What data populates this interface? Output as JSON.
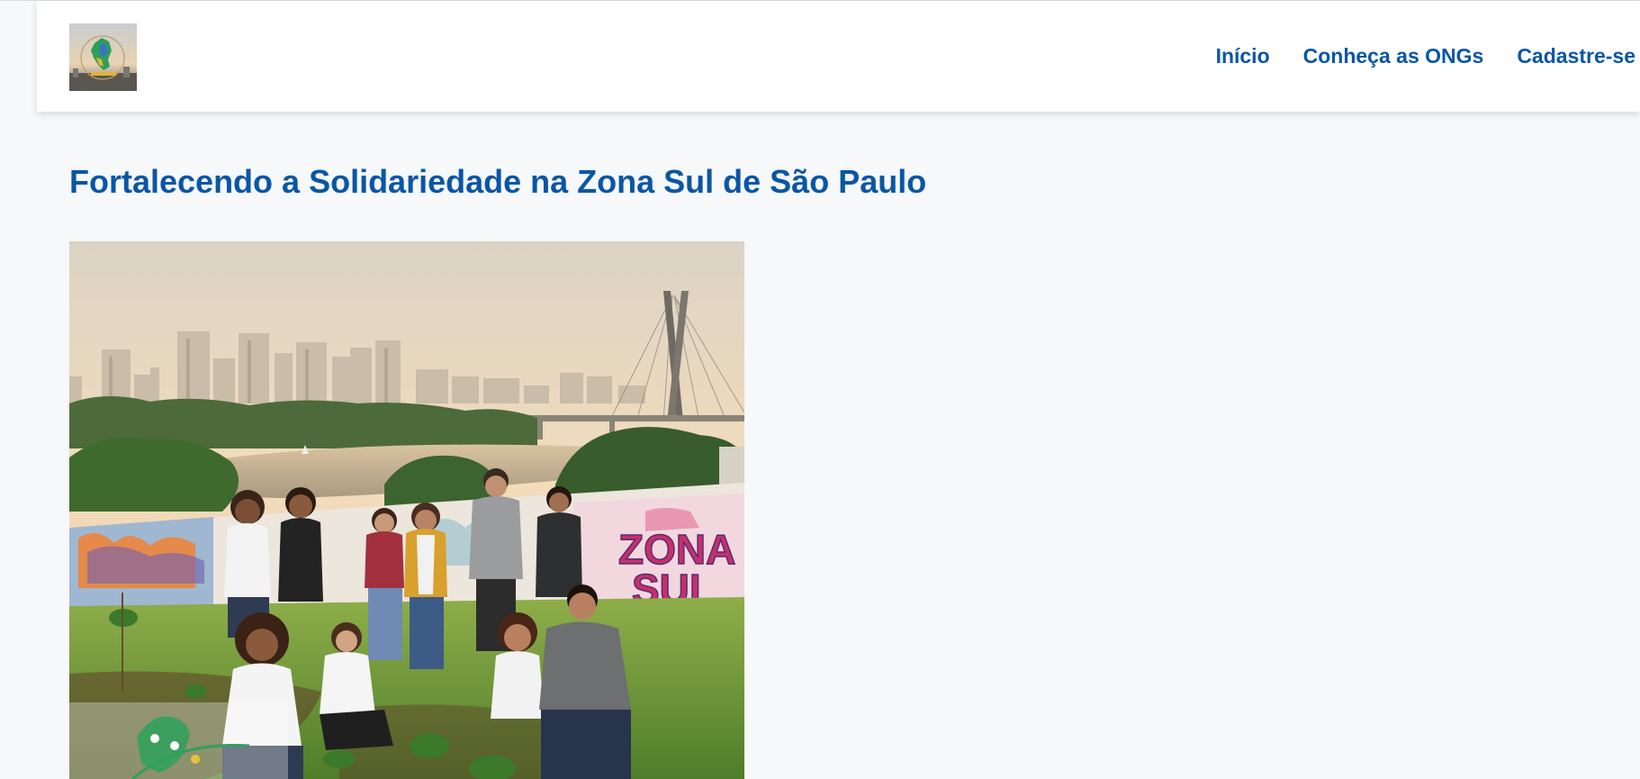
{
  "header": {
    "logo_icon": "sao-paulo-map-logo-icon",
    "nav": [
      {
        "label": "Início"
      },
      {
        "label": "Conheça as ONGs"
      },
      {
        "label": "Cadastre-se"
      }
    ]
  },
  "hero": {
    "title": "Fortalecendo a Solidariedade na Zona Sul de São Paulo",
    "image_icon": "volunteers-community-garden-photo",
    "mural_text": [
      "ZONA",
      "SUL"
    ]
  },
  "colors": {
    "accent": "#0a56a5",
    "page_background": "#f6f8fa",
    "header_background": "#ffffff"
  }
}
